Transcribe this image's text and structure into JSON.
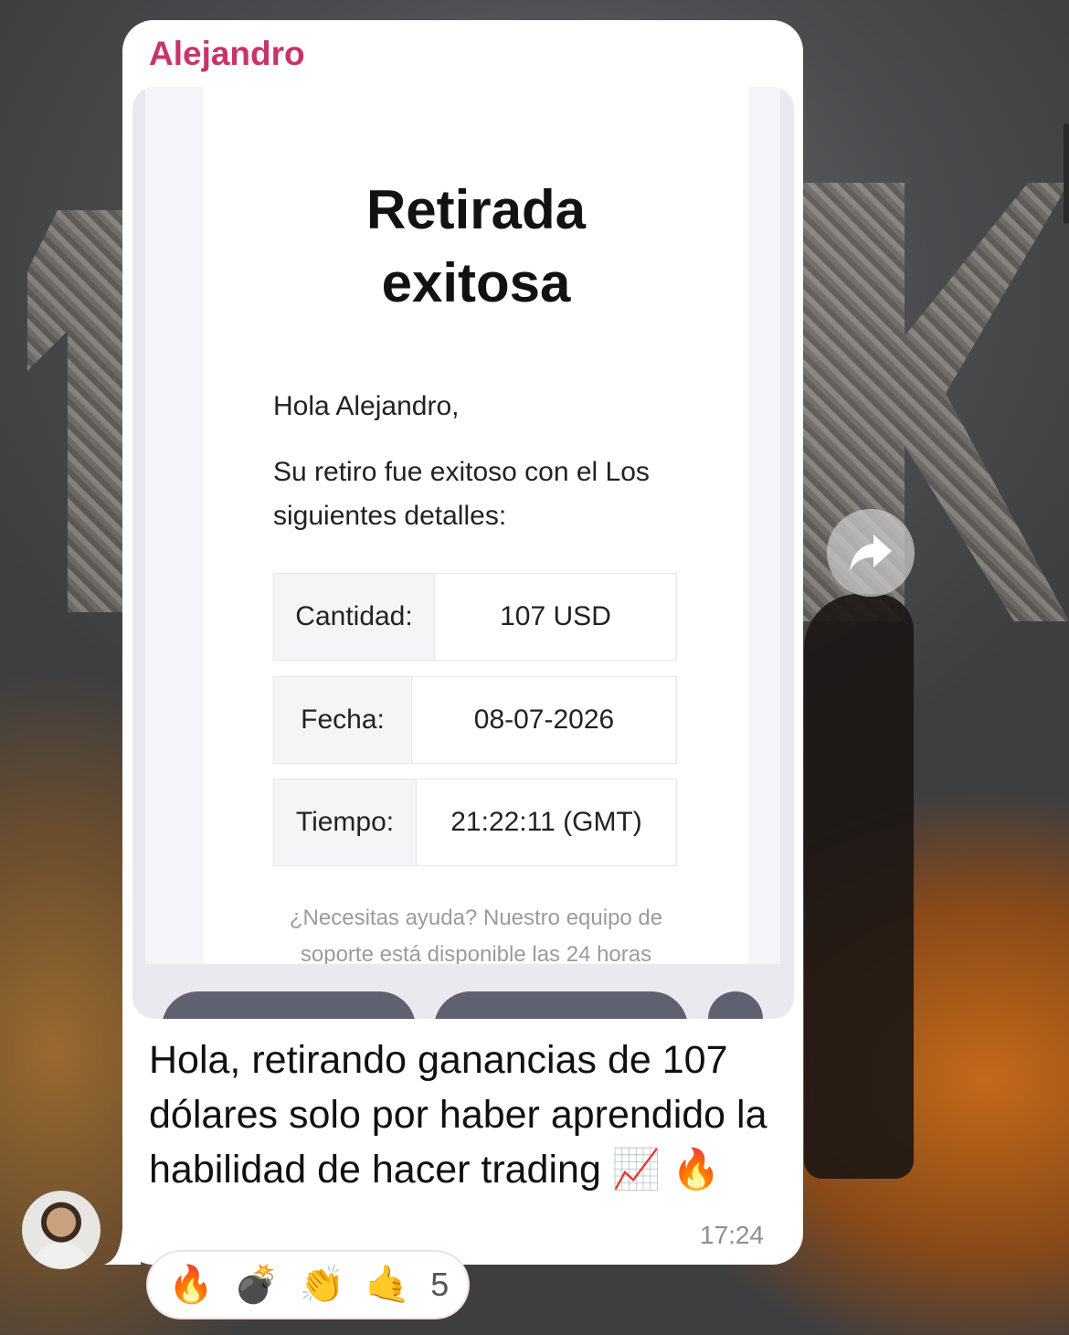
{
  "message": {
    "sender": "Alejandro",
    "email": {
      "title_line1": "Retirada",
      "title_line2": "exitosa",
      "greeting": "Hola Alejandro,",
      "intro": "Su retiro fue exitoso con el Los siguientes detalles:",
      "details": [
        {
          "label": "Cantidad:",
          "value": "107 USD"
        },
        {
          "label": "Fecha:",
          "value": "08-07-2026"
        },
        {
          "label": "Tiempo:",
          "value": "21:22:11 (GMT)"
        }
      ],
      "help_line1": "¿Necesitas ayuda? Nuestro equipo de",
      "help_line2": "soporte está disponible las 24 horas"
    },
    "caption": "Hola, retirando ganancias de 107 dólares solo por haber aprendido la habilidad de hacer trading 📈 🔥",
    "time": "17:24"
  },
  "reactions": {
    "emojis": [
      "🔥",
      "💣",
      "👏",
      "🤙"
    ],
    "count": "5"
  },
  "icons": {
    "forward": "forward-arrow-icon",
    "avatar": "user-avatar"
  },
  "colors": {
    "sender": "#c7346b",
    "bubble": "#ffffff",
    "time": "#8e8e93"
  }
}
